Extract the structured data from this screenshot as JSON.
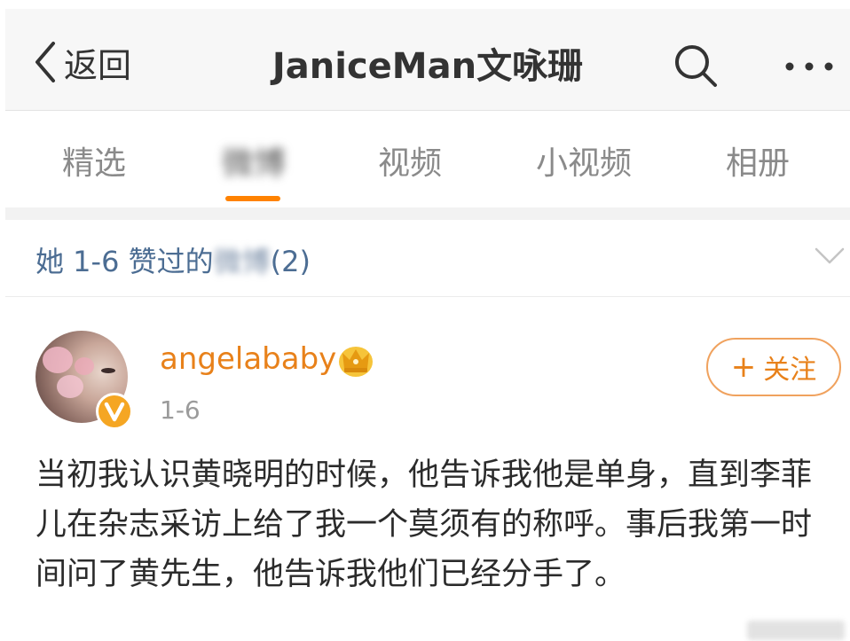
{
  "navbar": {
    "back_label": "返回",
    "title": "JaniceMan文咏珊"
  },
  "tabs": [
    {
      "label": "精选",
      "active": false
    },
    {
      "label": "微博",
      "active": true,
      "blurred": true
    },
    {
      "label": "视频",
      "active": false
    },
    {
      "label": "小视频",
      "active": false
    },
    {
      "label": "相册",
      "active": false
    }
  ],
  "colors": {
    "accent": "#ff8200",
    "username": "#e8811a",
    "section_title": "#4c6d93"
  },
  "section": {
    "title_prefix": "她 1-6 赞过的",
    "title_blurred": "微博",
    "title_count": "(2)"
  },
  "post": {
    "username": "angelababy",
    "date": "1-6",
    "follow_label": "关注",
    "text": "当初我认识黄晓明的时候，他告诉我他是单身，直到李菲儿在杂志采访上给了我一个莫须有的称呼。事后我第一时间问了黄先生，他告诉我他们已经分手了。",
    "icons": [
      "verified-icon",
      "crown-icon"
    ]
  }
}
